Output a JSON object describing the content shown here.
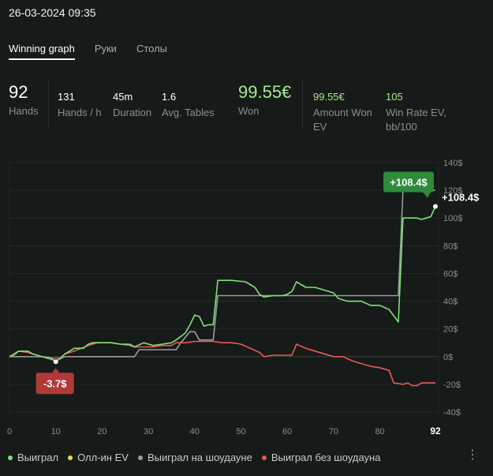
{
  "header": {
    "datetime": "26-03-2024 09:35"
  },
  "tabs": [
    {
      "label": "Winning graph",
      "active": true
    },
    {
      "label": "Руки",
      "active": false
    },
    {
      "label": "Столы",
      "active": false
    }
  ],
  "stats": {
    "hands": {
      "value": "92",
      "label": "Hands"
    },
    "hands_per_h": {
      "value": "131",
      "label": "Hands / h"
    },
    "duration": {
      "value": "45m",
      "label": "Duration"
    },
    "avg_tables": {
      "value": "1.6",
      "label": "Avg. Tables"
    },
    "won": {
      "value": "99.55€",
      "label": "Won"
    },
    "amount_won_ev": {
      "value": "99.55€",
      "label_1": "Amount Won",
      "label_2": "EV"
    },
    "win_rate_ev": {
      "value": "105",
      "label_1": "Win Rate EV,",
      "label_2": "bb/100"
    }
  },
  "colors": {
    "won": "#7fe07a",
    "allin_ev": "#e8d84a",
    "showdown": "#9a9a9a",
    "non_showdown": "#e85a55",
    "max_badge": "#2e8b3a",
    "min_badge": "#b03a3a"
  },
  "chart_data": {
    "type": "line",
    "x_ticks": [
      0,
      10,
      20,
      30,
      40,
      50,
      60,
      70,
      80,
      92
    ],
    "y_ticks": [
      "140$",
      "120$",
      "100$",
      "80$",
      "60$",
      "40$",
      "20$",
      "0$",
      "-20$",
      "-40$"
    ],
    "ylim": [
      -40,
      140
    ],
    "xlim": [
      0,
      92
    ],
    "grid": true,
    "legend_position": "bottom-left",
    "max_label": "+108.4$",
    "min_label": "-3.7$",
    "end_label": "+108.4$",
    "series": [
      {
        "name": "Выиграл",
        "key": "won",
        "points": [
          [
            0,
            0
          ],
          [
            1,
            2
          ],
          [
            2,
            4
          ],
          [
            4,
            4
          ],
          [
            5,
            2
          ],
          [
            6,
            1
          ],
          [
            7,
            0
          ],
          [
            9,
            -1
          ],
          [
            10,
            -3.7
          ],
          [
            11,
            -1
          ],
          [
            12,
            2
          ],
          [
            13,
            4
          ],
          [
            14,
            6
          ],
          [
            16,
            6
          ],
          [
            17,
            9
          ],
          [
            18,
            10
          ],
          [
            22,
            10
          ],
          [
            24,
            9
          ],
          [
            26,
            9
          ],
          [
            27,
            7
          ],
          [
            29,
            10
          ],
          [
            31,
            8
          ],
          [
            33,
            9
          ],
          [
            35,
            10
          ],
          [
            36,
            12
          ],
          [
            38,
            17
          ],
          [
            39,
            23
          ],
          [
            40,
            30
          ],
          [
            41,
            29
          ],
          [
            42,
            22
          ],
          [
            43,
            23
          ],
          [
            44,
            23
          ],
          [
            45,
            55
          ],
          [
            48,
            55
          ],
          [
            51,
            54
          ],
          [
            53,
            50
          ],
          [
            54,
            45
          ],
          [
            55,
            43
          ],
          [
            57,
            44
          ],
          [
            59,
            44
          ],
          [
            60,
            45
          ],
          [
            61,
            47
          ],
          [
            62,
            54
          ],
          [
            63,
            52
          ],
          [
            64,
            50
          ],
          [
            66,
            50
          ],
          [
            68,
            48
          ],
          [
            70,
            46
          ],
          [
            71,
            42
          ],
          [
            73,
            40
          ],
          [
            76,
            40
          ],
          [
            78,
            37
          ],
          [
            80,
            37
          ],
          [
            82,
            34
          ],
          [
            84,
            25
          ],
          [
            85,
            100
          ],
          [
            88,
            100
          ],
          [
            89,
            99
          ],
          [
            90,
            100
          ],
          [
            91,
            101
          ],
          [
            92,
            108.4
          ]
        ]
      },
      {
        "name": "Олл-ин EV",
        "key": "allin_ev",
        "points": []
      },
      {
        "name": "Выиграл на шоудауне",
        "key": "showdown",
        "points": [
          [
            0,
            0
          ],
          [
            7,
            0
          ],
          [
            10,
            -3
          ],
          [
            12,
            0
          ],
          [
            20,
            0
          ],
          [
            27,
            0
          ],
          [
            28,
            5
          ],
          [
            36,
            5
          ],
          [
            37,
            10
          ],
          [
            39,
            18
          ],
          [
            40,
            18
          ],
          [
            41,
            12
          ],
          [
            44,
            12
          ],
          [
            45,
            44
          ],
          [
            84,
            44
          ],
          [
            85,
            120
          ],
          [
            88,
            120
          ],
          [
            89,
            120
          ],
          [
            92,
            120
          ]
        ]
      },
      {
        "name": "Выиграл без шоудауна",
        "key": "non_showdown",
        "points": [
          [
            0,
            0
          ],
          [
            1,
            1
          ],
          [
            2,
            4
          ],
          [
            4,
            3
          ],
          [
            5,
            2
          ],
          [
            6,
            1
          ],
          [
            7,
            0
          ],
          [
            9,
            -1
          ],
          [
            10,
            -1
          ],
          [
            11,
            -1
          ],
          [
            12,
            2
          ],
          [
            14,
            4
          ],
          [
            17,
            8
          ],
          [
            19,
            10
          ],
          [
            22,
            10
          ],
          [
            24,
            9
          ],
          [
            26,
            8
          ],
          [
            27,
            7
          ],
          [
            29,
            7
          ],
          [
            31,
            7
          ],
          [
            33,
            8
          ],
          [
            35,
            8
          ],
          [
            36,
            10
          ],
          [
            38,
            10
          ],
          [
            40,
            11
          ],
          [
            42,
            11
          ],
          [
            44,
            11
          ],
          [
            46,
            10
          ],
          [
            48,
            10
          ],
          [
            50,
            9
          ],
          [
            52,
            6
          ],
          [
            54,
            3
          ],
          [
            55,
            0
          ],
          [
            57,
            1
          ],
          [
            59,
            1
          ],
          [
            61,
            1
          ],
          [
            62,
            9
          ],
          [
            64,
            6
          ],
          [
            66,
            4
          ],
          [
            68,
            2
          ],
          [
            70,
            0
          ],
          [
            72,
            0
          ],
          [
            74,
            -3
          ],
          [
            76,
            -5
          ],
          [
            78,
            -7
          ],
          [
            80,
            -8
          ],
          [
            82,
            -10
          ],
          [
            83,
            -19
          ],
          [
            85,
            -20
          ],
          [
            86,
            -19
          ],
          [
            87,
            -21
          ],
          [
            88,
            -21
          ],
          [
            89,
            -19
          ],
          [
            91,
            -19
          ],
          [
            92,
            -19
          ]
        ]
      }
    ]
  },
  "legend": [
    {
      "label": "Выиграл",
      "key": "won"
    },
    {
      "label": "Олл-ин EV",
      "key": "allin_ev"
    },
    {
      "label": "Выиграл на шоудауне",
      "key": "showdown"
    },
    {
      "label": "Выиграл без шоудауна",
      "key": "non_showdown"
    }
  ],
  "more_icon": "⋮"
}
